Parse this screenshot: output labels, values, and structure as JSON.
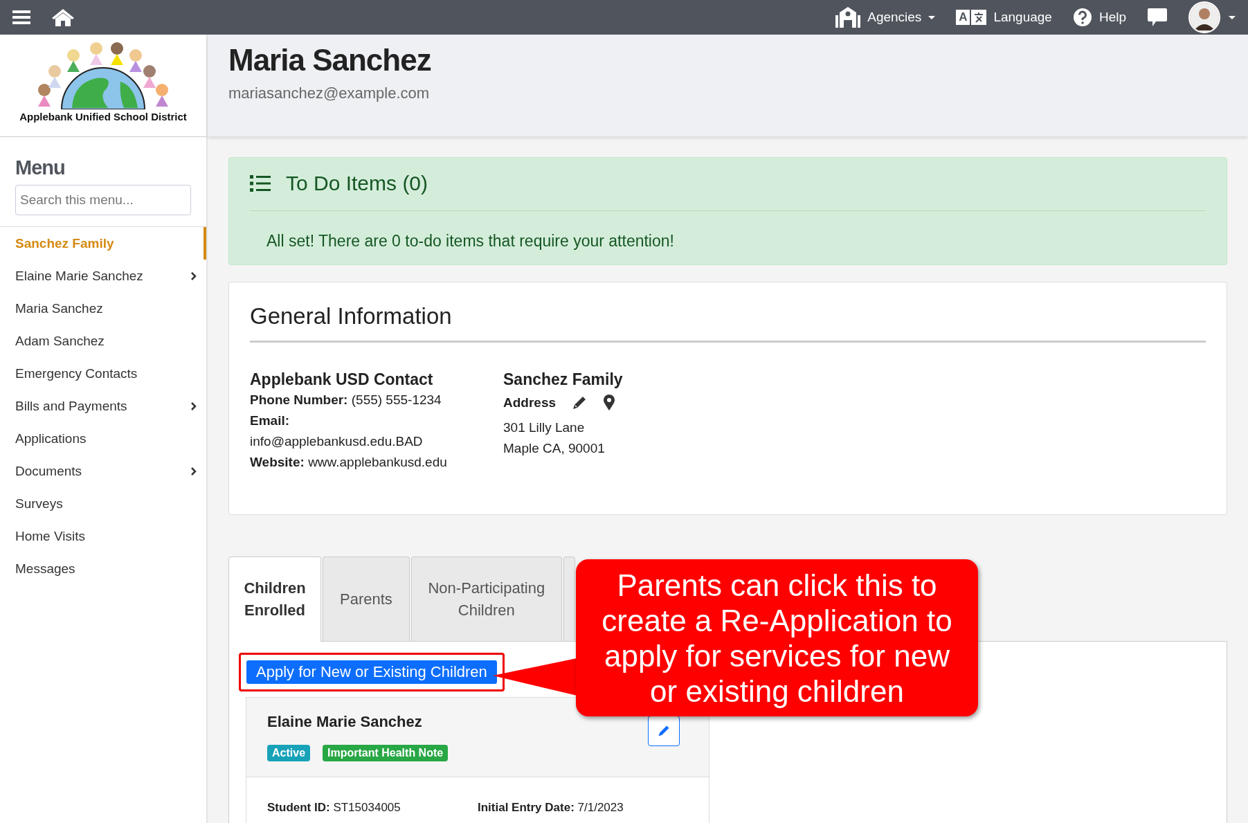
{
  "topbar": {
    "agencies": "Agencies",
    "language": "Language",
    "language_icon_letter": "A",
    "help": "Help"
  },
  "logo": {
    "caption": "Applebank Unified School District"
  },
  "user": {
    "name": "Maria Sanchez",
    "email": "mariasanchez@example.com"
  },
  "sidebar": {
    "title": "Menu",
    "search_placeholder": "Search this menu...",
    "items": [
      {
        "label": "Sanchez Family",
        "selected": true,
        "expandable": false
      },
      {
        "label": "Elaine Marie Sanchez",
        "selected": false,
        "expandable": true
      },
      {
        "label": "Maria Sanchez",
        "selected": false,
        "expandable": false
      },
      {
        "label": "Adam Sanchez",
        "selected": false,
        "expandable": false
      },
      {
        "label": "Emergency Contacts",
        "selected": false,
        "expandable": false
      },
      {
        "label": "Bills and Payments",
        "selected": false,
        "expandable": true
      },
      {
        "label": "Applications",
        "selected": false,
        "expandable": false
      },
      {
        "label": "Documents",
        "selected": false,
        "expandable": true
      },
      {
        "label": "Surveys",
        "selected": false,
        "expandable": false
      },
      {
        "label": "Home Visits",
        "selected": false,
        "expandable": false
      },
      {
        "label": "Messages",
        "selected": false,
        "expandable": false
      }
    ]
  },
  "todo": {
    "title": "To Do Items (0)",
    "message": "All set! There are 0 to-do items that require your attention!"
  },
  "general_info": {
    "title": "General Information",
    "contact": {
      "heading": "Applebank USD Contact",
      "lines": [
        {
          "label": "Phone Number:",
          "value": "(555) 555-1234"
        },
        {
          "label": "Email:",
          "value": "info@applebankusd.edu.BAD"
        },
        {
          "label": "Website:",
          "value": "www.applebankusd.edu"
        }
      ]
    },
    "family": {
      "heading": "Sanchez Family",
      "address_label": "Address",
      "address_lines": [
        "301 Lilly Lane",
        "Maple CA, 90001"
      ]
    }
  },
  "tabs": [
    {
      "label": "Children Enrolled",
      "selected": true
    },
    {
      "label": "Parents",
      "selected": false
    },
    {
      "label": "Non-Participating Children",
      "selected": false
    }
  ],
  "apply_button": "Apply for New or Existing Children",
  "child": {
    "name": "Elaine Marie Sanchez",
    "badges": [
      {
        "label": "Active",
        "color": "#17a2b8"
      },
      {
        "label": "Important Health Note",
        "color": "#28a745"
      }
    ],
    "fields": [
      {
        "label": "Student ID:",
        "value": "ST15034005"
      },
      {
        "label": "Initial Entry Date:",
        "value": "7/1/2023"
      }
    ]
  },
  "callout": {
    "text": "Parents can click this to create a Re-Application to apply for services for new or existing children"
  }
}
